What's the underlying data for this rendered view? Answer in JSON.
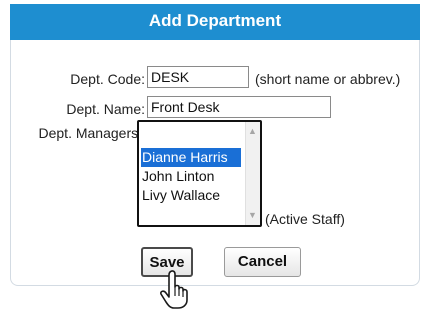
{
  "dialog": {
    "title": "Add Department",
    "code": {
      "label": "Dept. Code:",
      "value": "DESK",
      "hint": "(short name or abbrev.)"
    },
    "name": {
      "label": "Dept. Name:",
      "value": "Front Desk"
    },
    "managers": {
      "label": "Dept. Managers:",
      "options": [
        {
          "text": "Dianne Harris",
          "selected": true
        },
        {
          "text": "John Linton",
          "selected": false
        },
        {
          "text": "Livy Wallace",
          "selected": false
        }
      ],
      "hint": "(Active Staff)"
    },
    "save_label": "Save",
    "cancel_label": "Cancel"
  },
  "colors": {
    "title_bar": "#1e8ed0",
    "selection": "#1a6fd6"
  },
  "icons": [
    "hand-pointer-icon",
    "scroll-up-arrow-icon",
    "scroll-down-arrow-icon"
  ]
}
